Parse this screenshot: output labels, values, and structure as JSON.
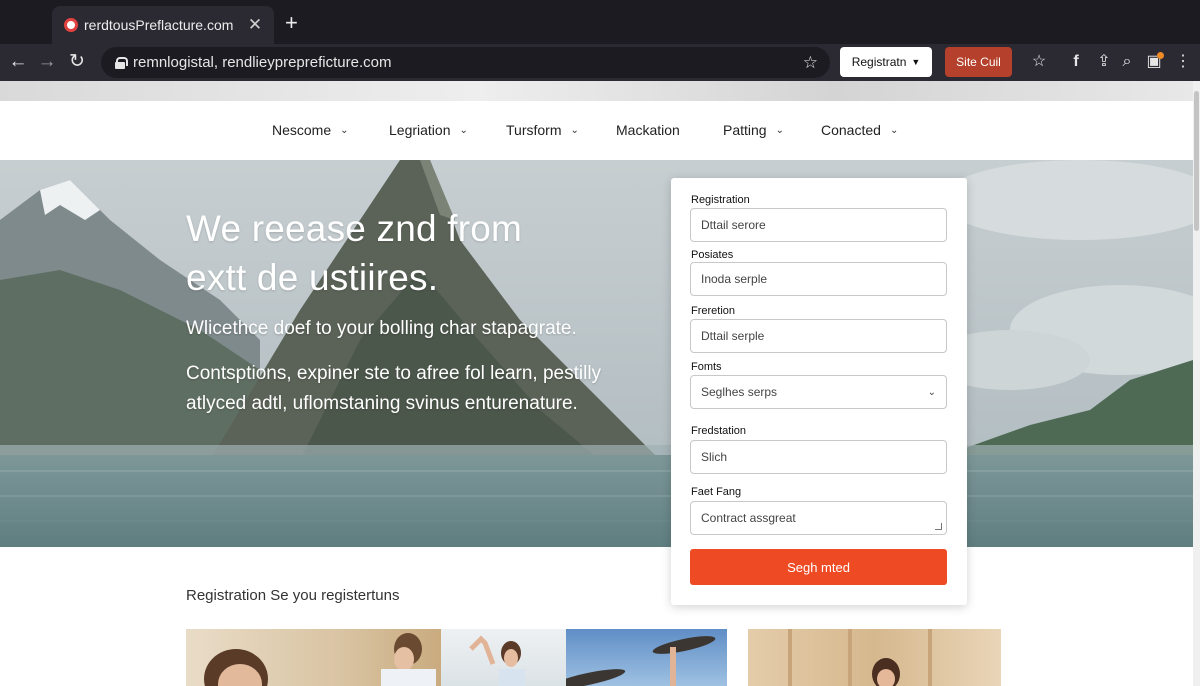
{
  "browser": {
    "tab_title": "rerdtousPreflacture.com",
    "tab_close": "✕",
    "new_tab": "+",
    "url": "remnlogistal, rendlieyprepreficture.com",
    "registration_button": "Registratn",
    "site_button": "Site Cuil"
  },
  "nav": {
    "items": [
      {
        "label": "Nescome",
        "has_dropdown": true
      },
      {
        "label": "Legriation",
        "has_dropdown": true
      },
      {
        "label": "Tursform",
        "has_dropdown": true
      },
      {
        "label": "Mackation",
        "has_dropdown": false
      },
      {
        "label": "Patting",
        "has_dropdown": true
      },
      {
        "label": "Conacted",
        "has_dropdown": true
      }
    ]
  },
  "hero": {
    "title_line1": "We reease znd from",
    "title_line2": "extt de ustiires.",
    "subtitle": "Wlicethce doef to your bolling char stapagrate.",
    "desc_line1": "Contsptions, expiner ste to afree fol learn, pestilly",
    "desc_line2": "atlyced adtl, uflomstaning svinus enturenature."
  },
  "form": {
    "fields": [
      {
        "label": "Registration",
        "value": "Dttail serore"
      },
      {
        "label": "Posiates",
        "value": "Inoda serple"
      },
      {
        "label": "Freretion",
        "value": "Dttail serple"
      },
      {
        "label": "Fomts",
        "value": "Seglhes serps"
      },
      {
        "label": "Fredstation",
        "value": "Slich"
      },
      {
        "label": "Faet Fang",
        "value": "Contract assgreat"
      }
    ],
    "submit_label": "Segh mted"
  },
  "section": {
    "title": "Registration Se you registertuns"
  }
}
